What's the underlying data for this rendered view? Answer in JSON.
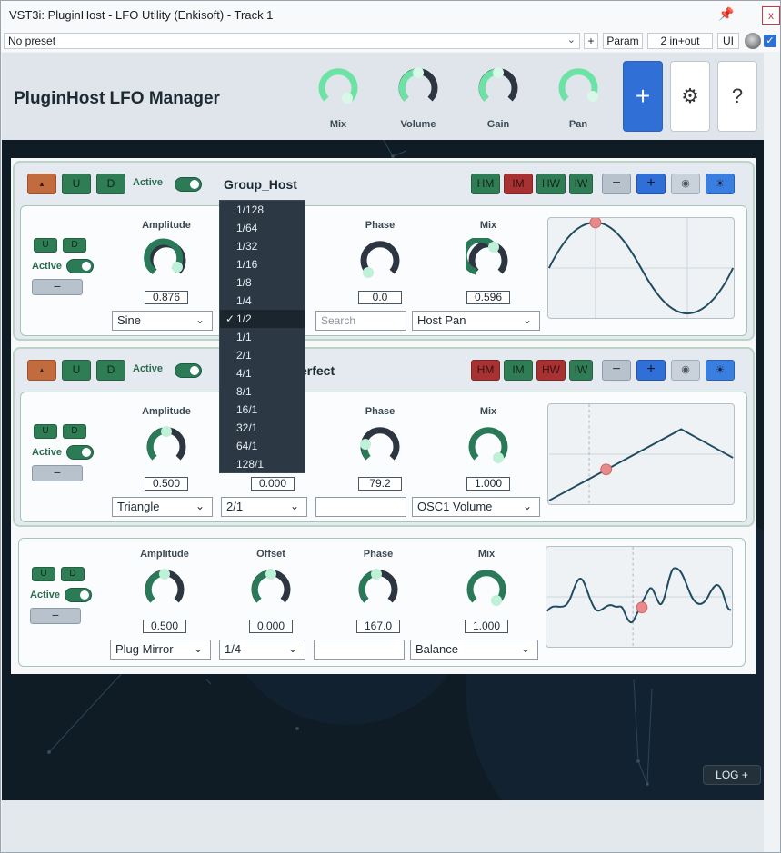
{
  "window": {
    "title": "VST3i: PluginHost - LFO Utility (Enkisoft) - Track 1",
    "close": "x"
  },
  "toolbar": {
    "preset": "No preset",
    "plus": "+",
    "param": "Param",
    "io": "2 in+out",
    "ui": "UI"
  },
  "header": {
    "title": "PluginHost LFO Manager",
    "knobs": [
      {
        "label": "Mix"
      },
      {
        "label": "Volume"
      },
      {
        "label": "Gain"
      },
      {
        "label": "Pan"
      }
    ],
    "add": "+",
    "settings": "⚙",
    "help": "?"
  },
  "groups": [
    {
      "name": "Group_Host",
      "active_label": "Active",
      "up": "U",
      "down": "D",
      "buttons": [
        "HM",
        "IM",
        "HW",
        "IW",
        "−",
        "+"
      ]
    },
    {
      "name": "…erfect",
      "active_label": "Active",
      "up": "U",
      "down": "D",
      "buttons": [
        "HM",
        "IM",
        "HW",
        "IW",
        "−",
        "+"
      ]
    }
  ],
  "lfos": [
    {
      "amp_label": "Amplitude",
      "offset_label": "Offset",
      "phase_label": "Phase",
      "mix_label": "Mix",
      "amplitude": "0.876",
      "offset": "",
      "phase": "0.0",
      "mix": "0.596",
      "wave": "Sine",
      "rate": "1/2",
      "search_placeholder": "Search",
      "target": "Host Pan",
      "up": "U",
      "down": "D",
      "active": "Active",
      "remove": "−"
    },
    {
      "amp_label": "Amplitude",
      "offset_label": "Offset",
      "phase_label": "Phase",
      "mix_label": "Mix",
      "amplitude": "0.500",
      "offset": "0.000",
      "phase": "79.2",
      "mix": "1.000",
      "wave": "Triangle",
      "rate": "2/1",
      "search_placeholder": "",
      "target": "OSC1 Volume",
      "up": "U",
      "down": "D",
      "active": "Active",
      "remove": "−"
    },
    {
      "amp_label": "Amplitude",
      "offset_label": "Offset",
      "phase_label": "Phase",
      "mix_label": "Mix",
      "amplitude": "0.500",
      "offset": "0.000",
      "phase": "167.0",
      "mix": "1.000",
      "wave": "Plug Mirror",
      "rate": "1/4",
      "search_placeholder": "",
      "target": "Balance",
      "up": "U",
      "down": "D",
      "active": "Active",
      "remove": "−"
    }
  ],
  "rate_dropdown": {
    "options": [
      "1/128",
      "1/64",
      "1/32",
      "1/16",
      "1/8",
      "1/4",
      "1/2",
      "1/1",
      "2/1",
      "4/1",
      "8/1",
      "16/1",
      "32/1",
      "64/1",
      "128/1"
    ],
    "selected": "1/2",
    "check": "✓"
  },
  "footer": {
    "log": "LOG +"
  },
  "colors": {
    "accent": "#2f6fd6",
    "green": "#2f7d55",
    "red": "#a83232",
    "knob_fill": "#2a7a5a",
    "knob_track": "#2c3540",
    "dot": "#bff0d8"
  }
}
